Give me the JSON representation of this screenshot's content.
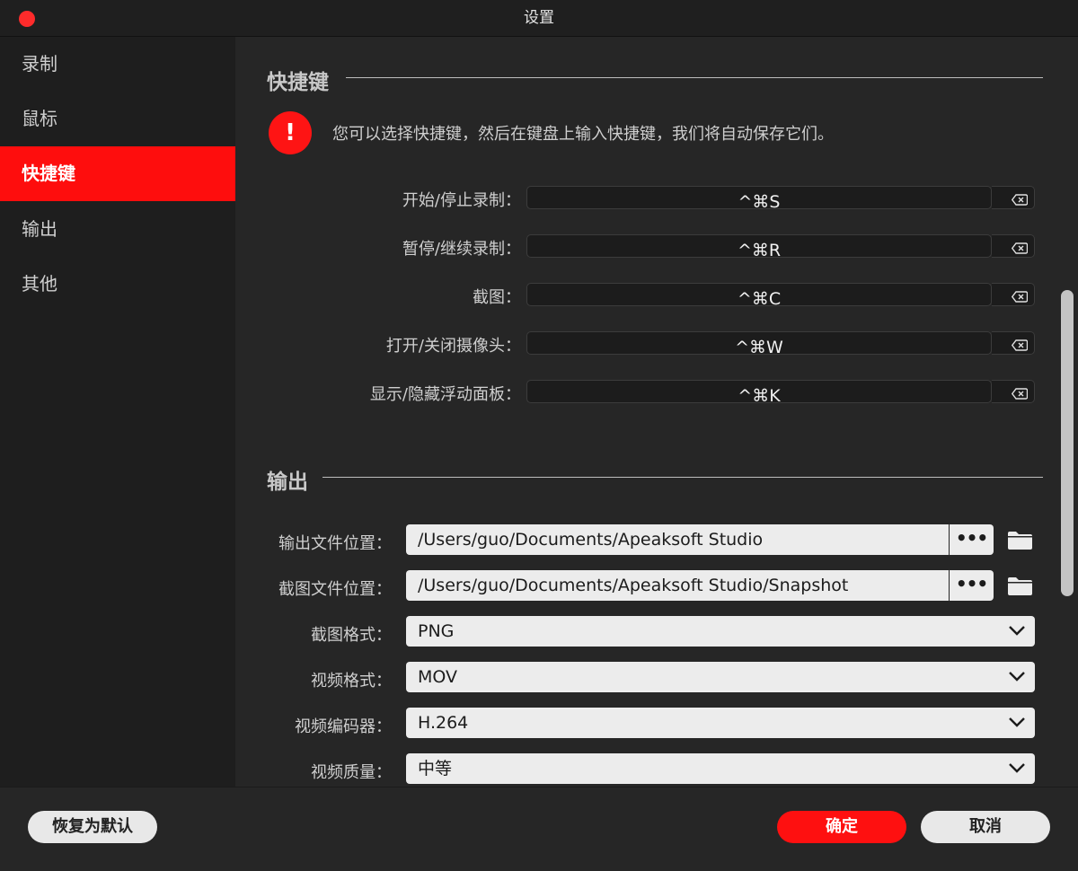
{
  "window": {
    "title": "设置",
    "close_color": "#fe2b2b"
  },
  "sidebar": {
    "items": [
      {
        "label": "录制",
        "active": false
      },
      {
        "label": "鼠标",
        "active": false
      },
      {
        "label": "快捷键",
        "active": true
      },
      {
        "label": "输出",
        "active": false
      },
      {
        "label": "其他",
        "active": false
      }
    ],
    "active_color": "#fe0d0d"
  },
  "shortcuts": {
    "section_title": "快捷键",
    "alert_icon": "!",
    "alert_text": "您可以选择快捷键，然后在键盘上输入快捷键，我们将自动保存它们。",
    "rows": [
      {
        "label": "开始/停止录制：",
        "value": "^⌘S"
      },
      {
        "label": "暂停/继续录制：",
        "value": "^⌘R"
      },
      {
        "label": "截图：",
        "value": "^⌘C"
      },
      {
        "label": "打开/关闭摄像头：",
        "value": "^⌘W"
      },
      {
        "label": "显示/隐藏浮动面板：",
        "value": "^⌘K"
      }
    ]
  },
  "output": {
    "section_title": "输出",
    "output_path_label": "输出文件位置：",
    "output_path_value": "/Users/guo/Documents/Apeaksoft Studio",
    "snapshot_path_label": "截图文件位置：",
    "snapshot_path_value": "/Users/guo/Documents/Apeaksoft Studio/Snapshot",
    "browse_label": "•••",
    "snapshot_format_label": "截图格式：",
    "snapshot_format_value": "PNG",
    "video_format_label": "视频格式：",
    "video_format_value": "MOV",
    "video_codec_label": "视频编码器：",
    "video_codec_value": "H.264",
    "video_quality_label": "视频质量：",
    "video_quality_value": "中等"
  },
  "footer": {
    "reset_label": "恢复为默认",
    "ok_label": "确定",
    "cancel_label": "取消",
    "ok_color": "#fe1010"
  }
}
